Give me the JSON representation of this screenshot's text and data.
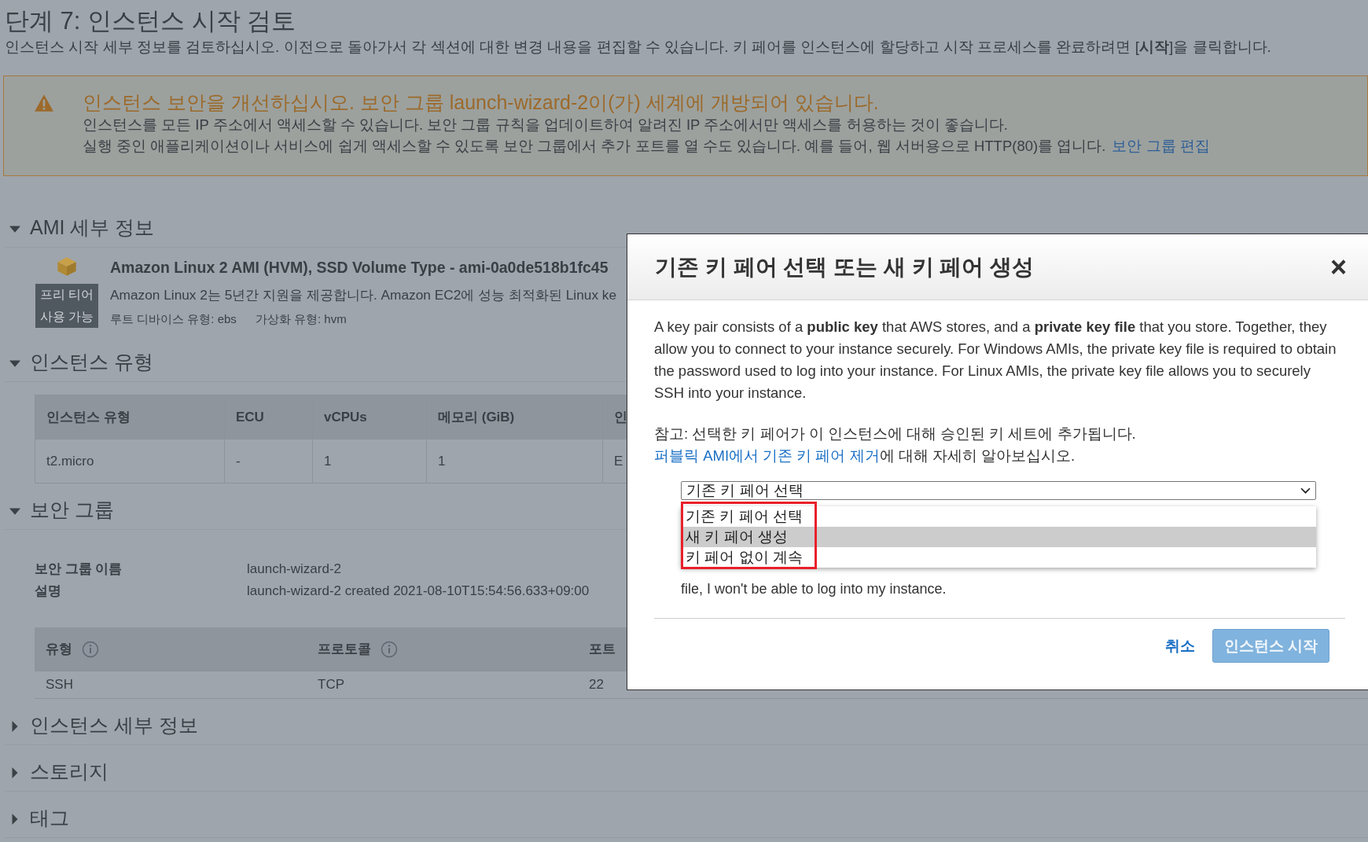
{
  "page": {
    "title": "단계 7: 인스턴스 시작 검토",
    "intro": "인스턴스 시작 세부 정보를 검토하십시오. 이전으로 돌아가서 각 섹션에 대한 변경 내용을 편집할 수 있습니다. 키 페어를 인스턴스에 할당하고 시작 프로세스를 완료하려면 [**시작**]을 클릭합니다."
  },
  "alert": {
    "title": "인스턴스 보안을 개선하십시오. 보안 그룹 launch-wizard-2이(가) 세계에 개방되어 있습니다.",
    "lines": [
      "인스턴스를 모든 IP 주소에서 액세스할 수 있습니다. 보안 그룹 규칙을 업데이트하여 알려진 IP 주소에서만 액세스를 허용하는 것이 좋습니다.",
      "실행 중인 애플리케이션이나 서비스에 쉽게 액세스할 수 있도록 보안 그룹에서 추가 포트를 열 수도 있습니다. 예를 들어, 웹 서버용으로 HTTP(80)를 엽니다."
    ],
    "link": "보안 그룹 편집"
  },
  "sections": [
    {
      "kind": "ami",
      "title": "AMI 세부 정보",
      "expanded": true,
      "ami": {
        "name": "Amazon Linux 2 AMI (HVM), SSD Volume Type - ami-0a0de518b1fc45",
        "badge": [
          "프리 티어",
          "사용 가능"
        ],
        "description": "Amazon Linux 2는 5년간 지원을 제공합니다. Amazon EC2에 성능 최적화된 Linux ke",
        "meta": [
          "루트 디바이스 유형: ebs",
          "가상화 유형: hvm"
        ]
      }
    },
    {
      "kind": "instance_type",
      "title": "인스턴스 유형",
      "expanded": true,
      "table": {
        "columns": [
          {
            "label": "인스턴스 유형",
            "info": false
          },
          {
            "label": "ECU",
            "info": false
          },
          {
            "label": "vCPUs",
            "info": false
          },
          {
            "label": "메모리 (GiB)",
            "info": false
          },
          {
            "label": "인",
            "info": false
          }
        ],
        "rows": [
          [
            "t2.micro",
            "-",
            "1",
            "1",
            "E"
          ]
        ]
      }
    },
    {
      "kind": "security_group",
      "title": "보안 그룹",
      "expanded": true,
      "fields": [
        {
          "label": "보안 그룹 이름",
          "value": "launch-wizard-2"
        },
        {
          "label": "설명",
          "value": "launch-wizard-2 created 2021-08-10T15:54:56.633+09:00"
        }
      ],
      "table": {
        "columns": [
          {
            "label": "유형",
            "info": true
          },
          {
            "label": "프로토콜",
            "info": true
          },
          {
            "label": "포트",
            "info": false
          }
        ],
        "rows": [
          [
            "SSH",
            "TCP",
            "22"
          ]
        ]
      }
    },
    {
      "title": "인스턴스 세부 정보",
      "expanded": false
    },
    {
      "title": "스토리지",
      "expanded": false
    },
    {
      "title": "태그",
      "expanded": false
    }
  ],
  "modal": {
    "title": "기존 키 페어 선택 또는 새 키 페어 생성",
    "close": "×",
    "body": "A key pair consists of a **public key** that AWS stores, and a **private key file** that you store. Together, they allow you to connect to your instance securely. For Windows AMIs, the private key file is required to obtain the password used to log into your instance. For Linux AMIs, the private key file allows you to securely SSH into your instance.",
    "note": "참고: 선택한 키 페어가 이 인스턴스에 대해 승인된 키 세트에 추가됩니다.",
    "note_link": "퍼블릭 AMI에서 기존 키 페어 제거",
    "note_tail": "에 대해 자세히 알아보십시오.",
    "select": {
      "value": "기존 키 페어 선택",
      "expanded": true,
      "options": [
        {
          "label": "기존 키 페어 선택",
          "highlighted": false
        },
        {
          "label": "새 키 페어 생성",
          "highlighted": true
        },
        {
          "label": "키 페어 없이 계속",
          "highlighted": false
        }
      ]
    },
    "acknowledge_tail": "file, I won't be able to log into my instance.",
    "cancel": "취소",
    "launch": {
      "label": "인스턴스 시작",
      "disabled": true
    }
  }
}
